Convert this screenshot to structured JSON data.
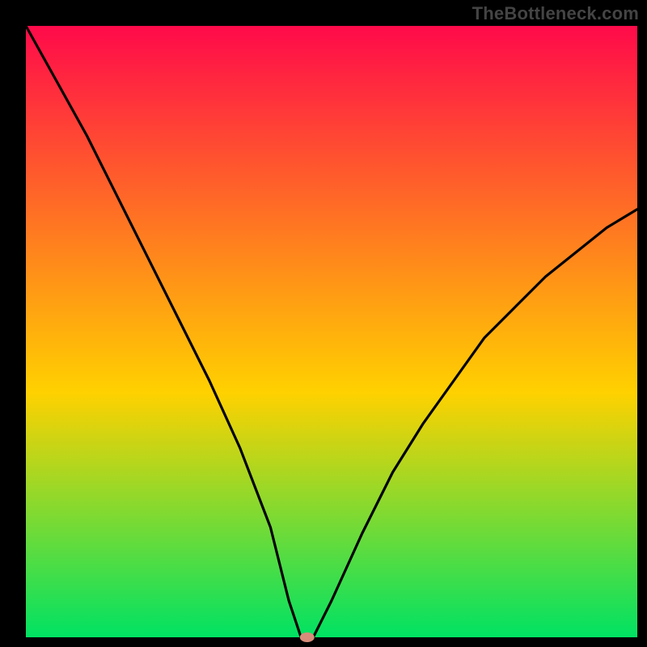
{
  "watermark": "TheBottleneck.com",
  "chart_data": {
    "type": "line",
    "title": "",
    "xlabel": "",
    "ylabel": "",
    "xlim": [
      0,
      100
    ],
    "ylim": [
      0,
      100
    ],
    "x": [
      0,
      5,
      10,
      15,
      20,
      25,
      30,
      35,
      40,
      43,
      45,
      47,
      50,
      55,
      60,
      65,
      70,
      75,
      80,
      85,
      90,
      95,
      100
    ],
    "values": [
      100,
      91,
      82,
      72,
      62,
      52,
      42,
      31,
      18,
      6,
      0,
      0,
      6,
      17,
      27,
      35,
      42,
      49,
      54,
      59,
      63,
      67,
      70
    ],
    "notch": {
      "x": 46,
      "y": 0
    },
    "gradient": {
      "top": "#ff0a4a",
      "mid": "#ffd100",
      "bottom": "#00e263"
    }
  }
}
